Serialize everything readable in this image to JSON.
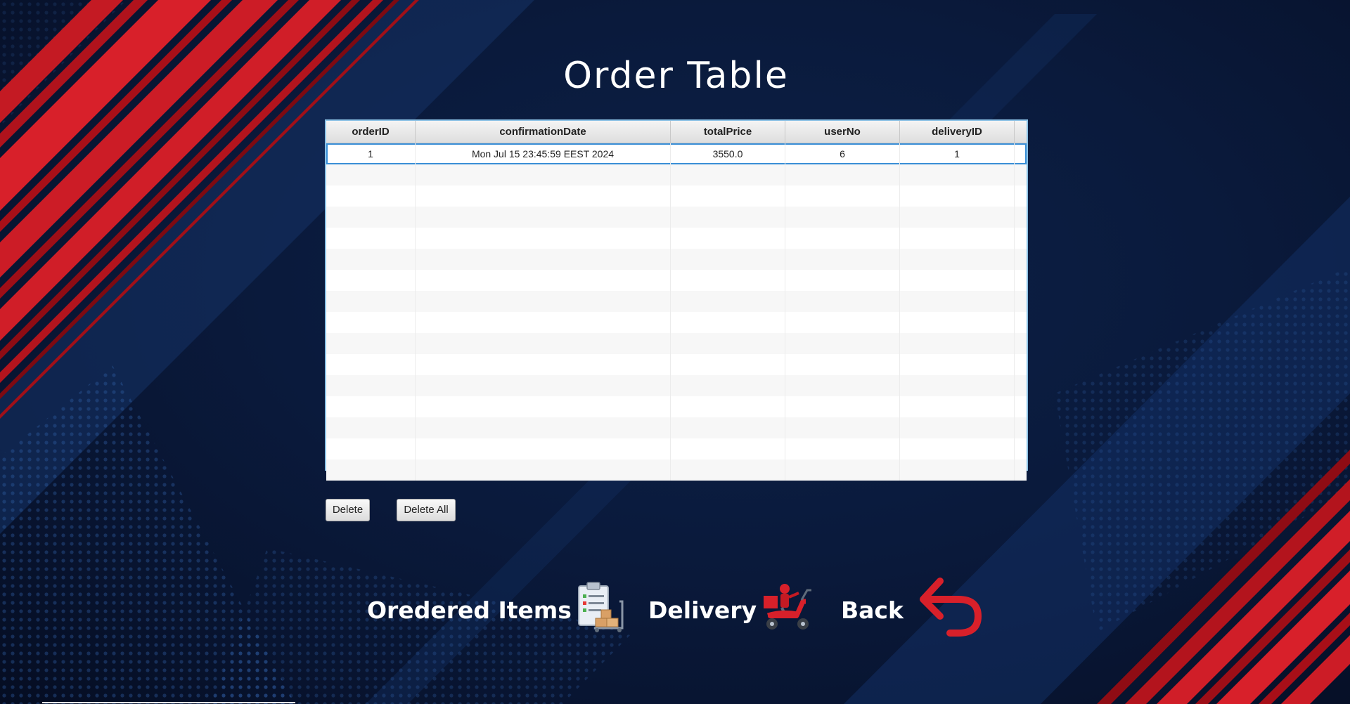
{
  "page": {
    "title": "Order Table"
  },
  "table": {
    "columns": [
      "orderID",
      "confirmationDate",
      "totalPrice",
      "userNo",
      "deliveryID"
    ],
    "rows": [
      {
        "orderID": "1",
        "confirmationDate": "Mon Jul 15 23:45:59 EEST 2024",
        "totalPrice": "3550.0",
        "userNo": "6",
        "deliveryID": "1",
        "selected": true
      }
    ],
    "empty_row_count": 15
  },
  "actions": {
    "delete_label": "Delete",
    "delete_all_label": "Delete All"
  },
  "nav": {
    "ordered_items_label": "Oredered Items",
    "ordered_items_icon": "clipboard-cart-icon",
    "delivery_label": "Delivery",
    "delivery_icon": "delivery-scooter-icon",
    "back_label": "Back",
    "back_icon": "back-arrow-icon"
  },
  "colors": {
    "background": "#0a1a3c",
    "accent_red": "#d8202a",
    "selection": "#3a8fd6"
  }
}
